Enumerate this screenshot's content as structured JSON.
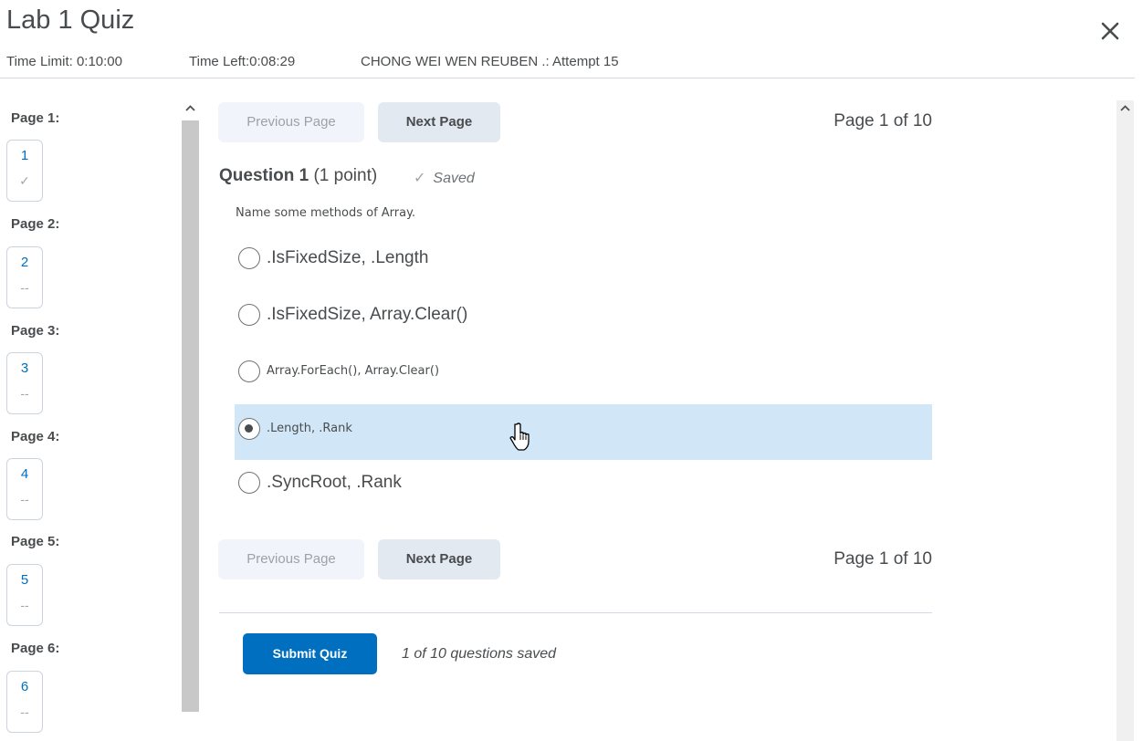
{
  "window": {
    "title": "Lab 1 Quiz",
    "close_icon": "close-icon"
  },
  "meta": {
    "time_limit": "Time Limit: 0:10:00",
    "time_left": "Time Left:0:08:29",
    "attempt": "CHONG WEI WEN REUBEN .: Attempt 15"
  },
  "page_nav": {
    "pages": [
      {
        "label": "Page 1:",
        "number": "1",
        "status": "✓",
        "status_icon": "checkmark-icon"
      },
      {
        "label": "Page 2:",
        "number": "2",
        "status": "--"
      },
      {
        "label": "Page 3:",
        "number": "3",
        "status": "--"
      },
      {
        "label": "Page 4:",
        "number": "4",
        "status": "--"
      },
      {
        "label": "Page 5:",
        "number": "5",
        "status": "--"
      },
      {
        "label": "Page 6:",
        "number": "6",
        "status": "--"
      }
    ]
  },
  "pager": {
    "previous_label": "Previous Page",
    "next_label": "Next Page",
    "page_indicator": "Page 1 of 10"
  },
  "question": {
    "title": "Question 1",
    "points": "(1 point)",
    "saved_label": "Saved",
    "text": "Name some methods of Array.",
    "options": [
      {
        "label": ".IsFixedSize, .Length",
        "selected": false
      },
      {
        "label": ".IsFixedSize, Array.Clear()",
        "selected": false
      },
      {
        "label": "Array.ForEach(), Array.Clear()",
        "selected": false
      },
      {
        "label": ".Length, .Rank",
        "selected": true
      },
      {
        "label": ".SyncRoot, .Rank",
        "selected": false
      }
    ]
  },
  "footer": {
    "submit_label": "Submit Quiz",
    "saved_count": "1 of 10 questions saved"
  },
  "colors": {
    "accent": "#006fbf",
    "selected_bg": "#d1e7f8",
    "text": "#494c4e"
  }
}
